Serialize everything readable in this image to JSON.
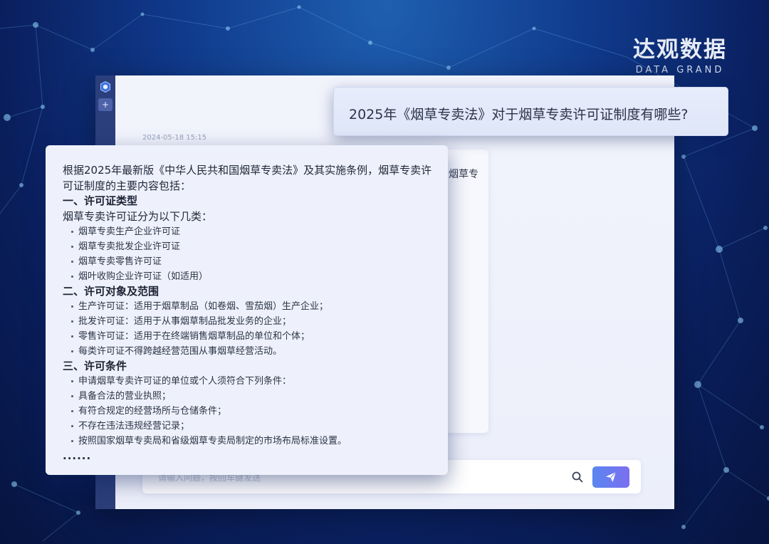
{
  "brand": {
    "name_cn": "达观数据",
    "name_en": "DATA GRAND"
  },
  "chat": {
    "timestamp": "2024-05-18 15:15",
    "question": "2025年《烟草专卖法》对于烟草专卖许可证制度有哪些?",
    "background_answer_fragment": "烟草专",
    "input_placeholder": "请输入问题，按回车键发送",
    "new_chat_symbol": "+"
  },
  "answer": {
    "intro": "根据2025年最新版《中华人民共和国烟草专卖法》及其实施条例，烟草专卖许可证制度的主要内容包括：",
    "sections": [
      {
        "title": "一、许可证类型",
        "subtitle": "烟草专卖许可证分为以下几类：",
        "items": [
          "烟草专卖生产企业许可证",
          "烟草专卖批发企业许可证",
          "烟草专卖零售许可证",
          "烟叶收购企业许可证（如适用）"
        ]
      },
      {
        "title": "二、许可对象及范围",
        "items": [
          "生产许可证：适用于烟草制品（如卷烟、雪茄烟）生产企业；",
          "批发许可证：适用于从事烟草制品批发业务的企业；",
          "零售许可证：适用于在终端销售烟草制品的单位和个体；",
          "每类许可证不得跨越经营范围从事烟草经营活动。"
        ]
      },
      {
        "title": "三、许可条件",
        "items": [
          "申请烟草专卖许可证的单位或个人须符合下列条件：",
          "具备合法的营业执照；",
          "有符合规定的经营场所与仓储条件；",
          "不存在违法违规经营记录；",
          "按照国家烟草专卖局和省级烟草专卖局制定的市场布局标准设置。"
        ]
      }
    ],
    "ellipsis": "......"
  },
  "colors": {
    "send_button_start": "#5a86f0",
    "send_button_end": "#7b6ff0",
    "sidebar": "#2b3f7d"
  },
  "icons": {
    "sidebar_logo": "hexagon-logo-icon",
    "search": "search-icon",
    "send": "send-icon"
  }
}
